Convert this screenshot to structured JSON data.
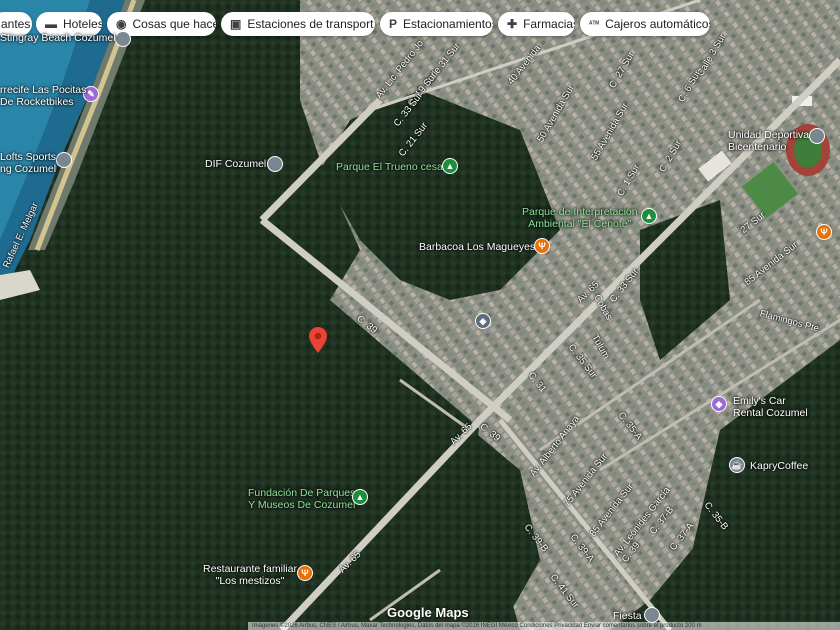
{
  "chips": [
    {
      "label": "antes",
      "icon": "restaurant-icon",
      "glyph": ""
    },
    {
      "label": "Hoteles",
      "icon": "bed-icon",
      "glyph": "▬"
    },
    {
      "label": "Cosas que hacer",
      "icon": "camera-icon",
      "glyph": "◉"
    },
    {
      "label": "Estaciones de transport…",
      "icon": "bus-icon",
      "glyph": "▣"
    },
    {
      "label": "Estacionamientos",
      "icon": "parking-icon",
      "glyph": "P"
    },
    {
      "label": "Farmacias",
      "icon": "pharmacy-icon",
      "glyph": "✚"
    },
    {
      "label": "Cajeros automáticos",
      "icon": "atm-icon",
      "glyph": "ᴬᵀᴹ"
    }
  ],
  "places": {
    "stingray": "Stingray Beach Cozumel",
    "arrecife": "rrecife Las Pocitas\nDe Rocketbikes",
    "lofts": "Lofts Sports\nng Cozumel",
    "dif": "DIF Cozumel",
    "trueno": "Parque El Trueno cesar",
    "interpretacion": "Parque de Interpretación\nAmbiental \"El Cenote\"",
    "barbacoa": "Barbacoa Los Magueyes",
    "unidad": "Unidad Deportiva\nBicentenario",
    "emily": "Emily's Car\nRental Cozumel",
    "kapry": "KapryCoffee",
    "fundacion": "Fundación De Parques\nY Museos De Cozumel",
    "restaurante": "Restaurante familiar\n\"Los mestizos\"",
    "fiesta": "Fiesta"
  },
  "roads": {
    "c39a": "C. 39",
    "c39b": "C. 39",
    "av65a": "Av. 65",
    "av65b": "Av. 65",
    "av65c": "Av. 65",
    "alberto": "Av. Alberto Anaya",
    "leonides": "Av. Leónides García",
    "lic": "Av. Lic. Pedro Jo",
    "calle31": "Calle 31 Sur",
    "s19": "C. 19 Sur",
    "s33": "C. 33 Sur",
    "s21": "C. 21 Sur",
    "av40": "40 Avenida",
    "av50": "50 Avenida Sur",
    "av55": "55 Avenida Sur",
    "s27": "C. 27 Sur",
    "s3": "Calle 3 Sur",
    "s6": "C. 6 Sur",
    "s2": "C. 2 Sur",
    "s1": "C. 1 Sur",
    "s27b": "27 Sur",
    "av85a": "85 Avenida Sur",
    "av85b": "85 Avenida Sur",
    "av75": "75 Avenida Sur",
    "s33b": "C. 33 Sur",
    "s35": "C. 35 Sur",
    "s31": "C. 31",
    "s35a": "C. 35-A",
    "s35b": "C. 35-B",
    "s37b": "C. 37-B",
    "s37a": "C. 37-A",
    "s39b": "C. 39-B",
    "s39a": "C. 39-A",
    "s41": "C. 41 Sur",
    "s39c": "C. 39",
    "flamingos": "Flamingos Pte.",
    "tulum": "Tulum",
    "cobas": "Cobas",
    "melgar": "Rafael E. Melgar"
  },
  "logo": "Google Maps",
  "attribution": "Imágenes ©2026 Airbus, CNES / Airbus, Maxar Technologies, Datos del mapa ©2026 INEGI   México   Condiciones   Privacidad   Enviar comentarios sobre el producto   200 m",
  "colors": {
    "forest": "#1d2e1f",
    "urban": "#8a8f86",
    "sea": "#1f5f86",
    "road": "#d7d5cd",
    "pin_red": "#ea4335"
  }
}
